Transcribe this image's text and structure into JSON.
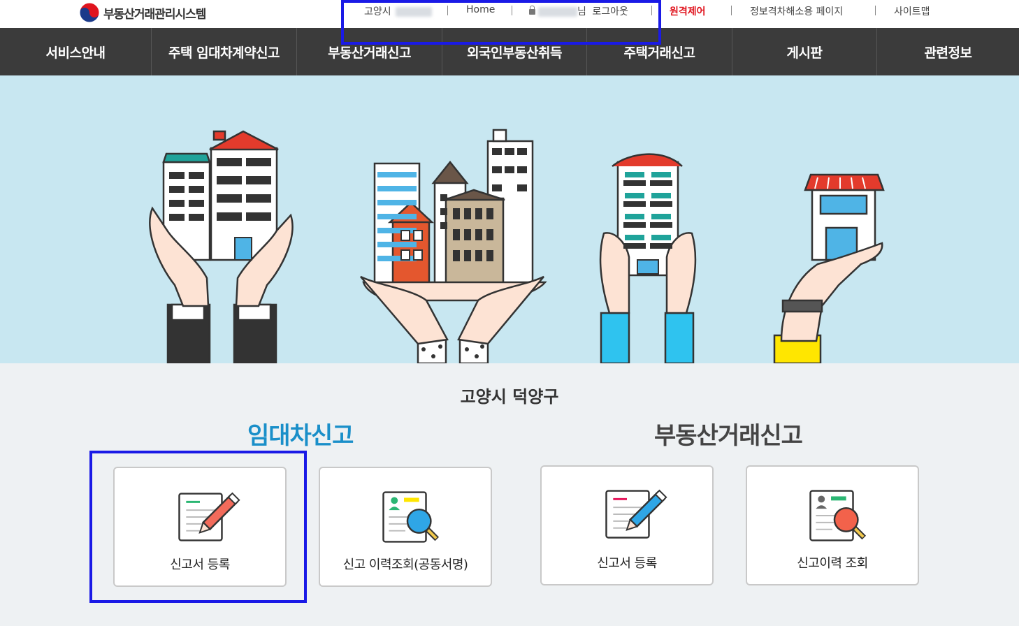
{
  "app": {
    "title": "부동산거래관리시스템"
  },
  "utility": {
    "region_label": "고양시",
    "home": "Home",
    "user_suffix": "님",
    "logout": "로그아웃",
    "remote": "원격제어",
    "accessibility": "정보격차해소용 페이지",
    "sitemap": "사이트맵"
  },
  "nav": {
    "items": [
      {
        "label": "서비스안내"
      },
      {
        "label": "주택 임대차계약신고"
      },
      {
        "label": "부동산거래신고"
      },
      {
        "label": "외국인부동산취득"
      },
      {
        "label": "주택거래신고"
      },
      {
        "label": "게시판"
      },
      {
        "label": "관련정보"
      }
    ]
  },
  "main": {
    "region": "고양시 덕양구",
    "lease": {
      "title": "임대차신고",
      "cards": [
        {
          "label": "신고서 등록",
          "icon": "document-pencil-icon"
        },
        {
          "label": "신고 이력조회(공동서명)",
          "icon": "document-magnifier-icon"
        }
      ]
    },
    "trade": {
      "title": "부동산거래신고",
      "cards": [
        {
          "label": "신고서 등록",
          "icon": "document-pencil-icon"
        },
        {
          "label": "신고이력 조회",
          "icon": "document-magnifier-icon"
        }
      ]
    }
  },
  "colors": {
    "nav_bg": "#3b3b3b",
    "hero_bg": "#c8e7f1",
    "lease_title": "#1a8fc9",
    "remote_red": "#e0141e",
    "highlight": "#1a1ae6"
  }
}
